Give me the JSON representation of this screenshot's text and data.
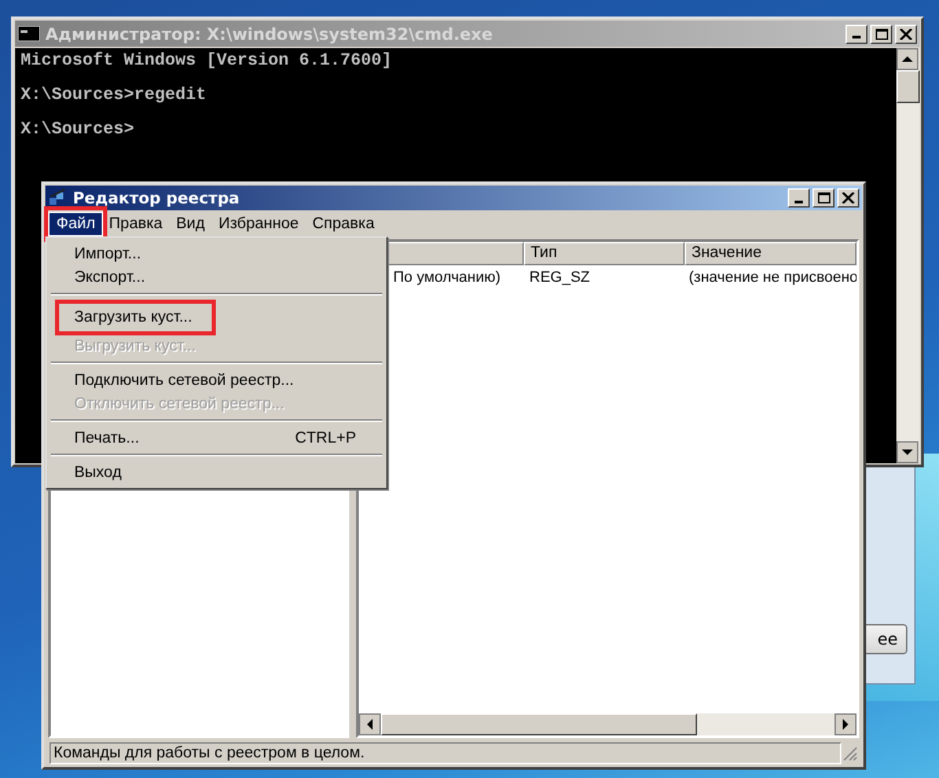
{
  "background_window": {
    "button": "ее"
  },
  "console": {
    "title": "Администратор: X:\\windows\\system32\\cmd.exe",
    "lines": [
      {
        "text": "Microsoft Windows [Version 6.1.7600]",
        "blank_before": false
      },
      {
        "text": "X:\\Sources>regedit",
        "blank_before": true
      },
      {
        "text": "X:\\Sources>",
        "blank_before": true
      }
    ]
  },
  "regedit": {
    "title": "Редактор реестра",
    "menu": [
      {
        "label": "Файл",
        "selected": true,
        "highlighted": true
      },
      {
        "label": "Правка",
        "selected": false,
        "highlighted": false
      },
      {
        "label": "Вид",
        "selected": false,
        "highlighted": false
      },
      {
        "label": "Избранное",
        "selected": false,
        "highlighted": false
      },
      {
        "label": "Справка",
        "selected": false,
        "highlighted": false
      }
    ],
    "file_menu": [
      {
        "kind": "item",
        "label": "Импорт...",
        "disabled": false,
        "highlighted": false
      },
      {
        "kind": "item",
        "label": "Экспорт...",
        "disabled": false,
        "highlighted": false
      },
      {
        "kind": "separator"
      },
      {
        "kind": "item",
        "label": "Загрузить куст...",
        "disabled": false,
        "highlighted": true
      },
      {
        "kind": "item",
        "label": "Выгрузить куст...",
        "disabled": true,
        "highlighted": false
      },
      {
        "kind": "separator"
      },
      {
        "kind": "item",
        "label": "Подключить сетевой реестр...",
        "disabled": false,
        "highlighted": false
      },
      {
        "kind": "item",
        "label": "Отключить сетевой реестр...",
        "disabled": true,
        "highlighted": false
      },
      {
        "kind": "separator"
      },
      {
        "kind": "item",
        "label": "Печать...",
        "shortcut": "CTRL+P",
        "disabled": false,
        "highlighted": false
      },
      {
        "kind": "separator"
      },
      {
        "kind": "item",
        "label": "Выход",
        "disabled": false,
        "highlighted": false
      }
    ],
    "table": {
      "columns": [
        "",
        "Тип",
        "Значение"
      ],
      "rows": [
        [
          "По умолчанию)",
          "REG_SZ",
          "(значение не присвоено"
        ]
      ]
    },
    "status_bar": "Команды для работы с реестром в целом."
  }
}
